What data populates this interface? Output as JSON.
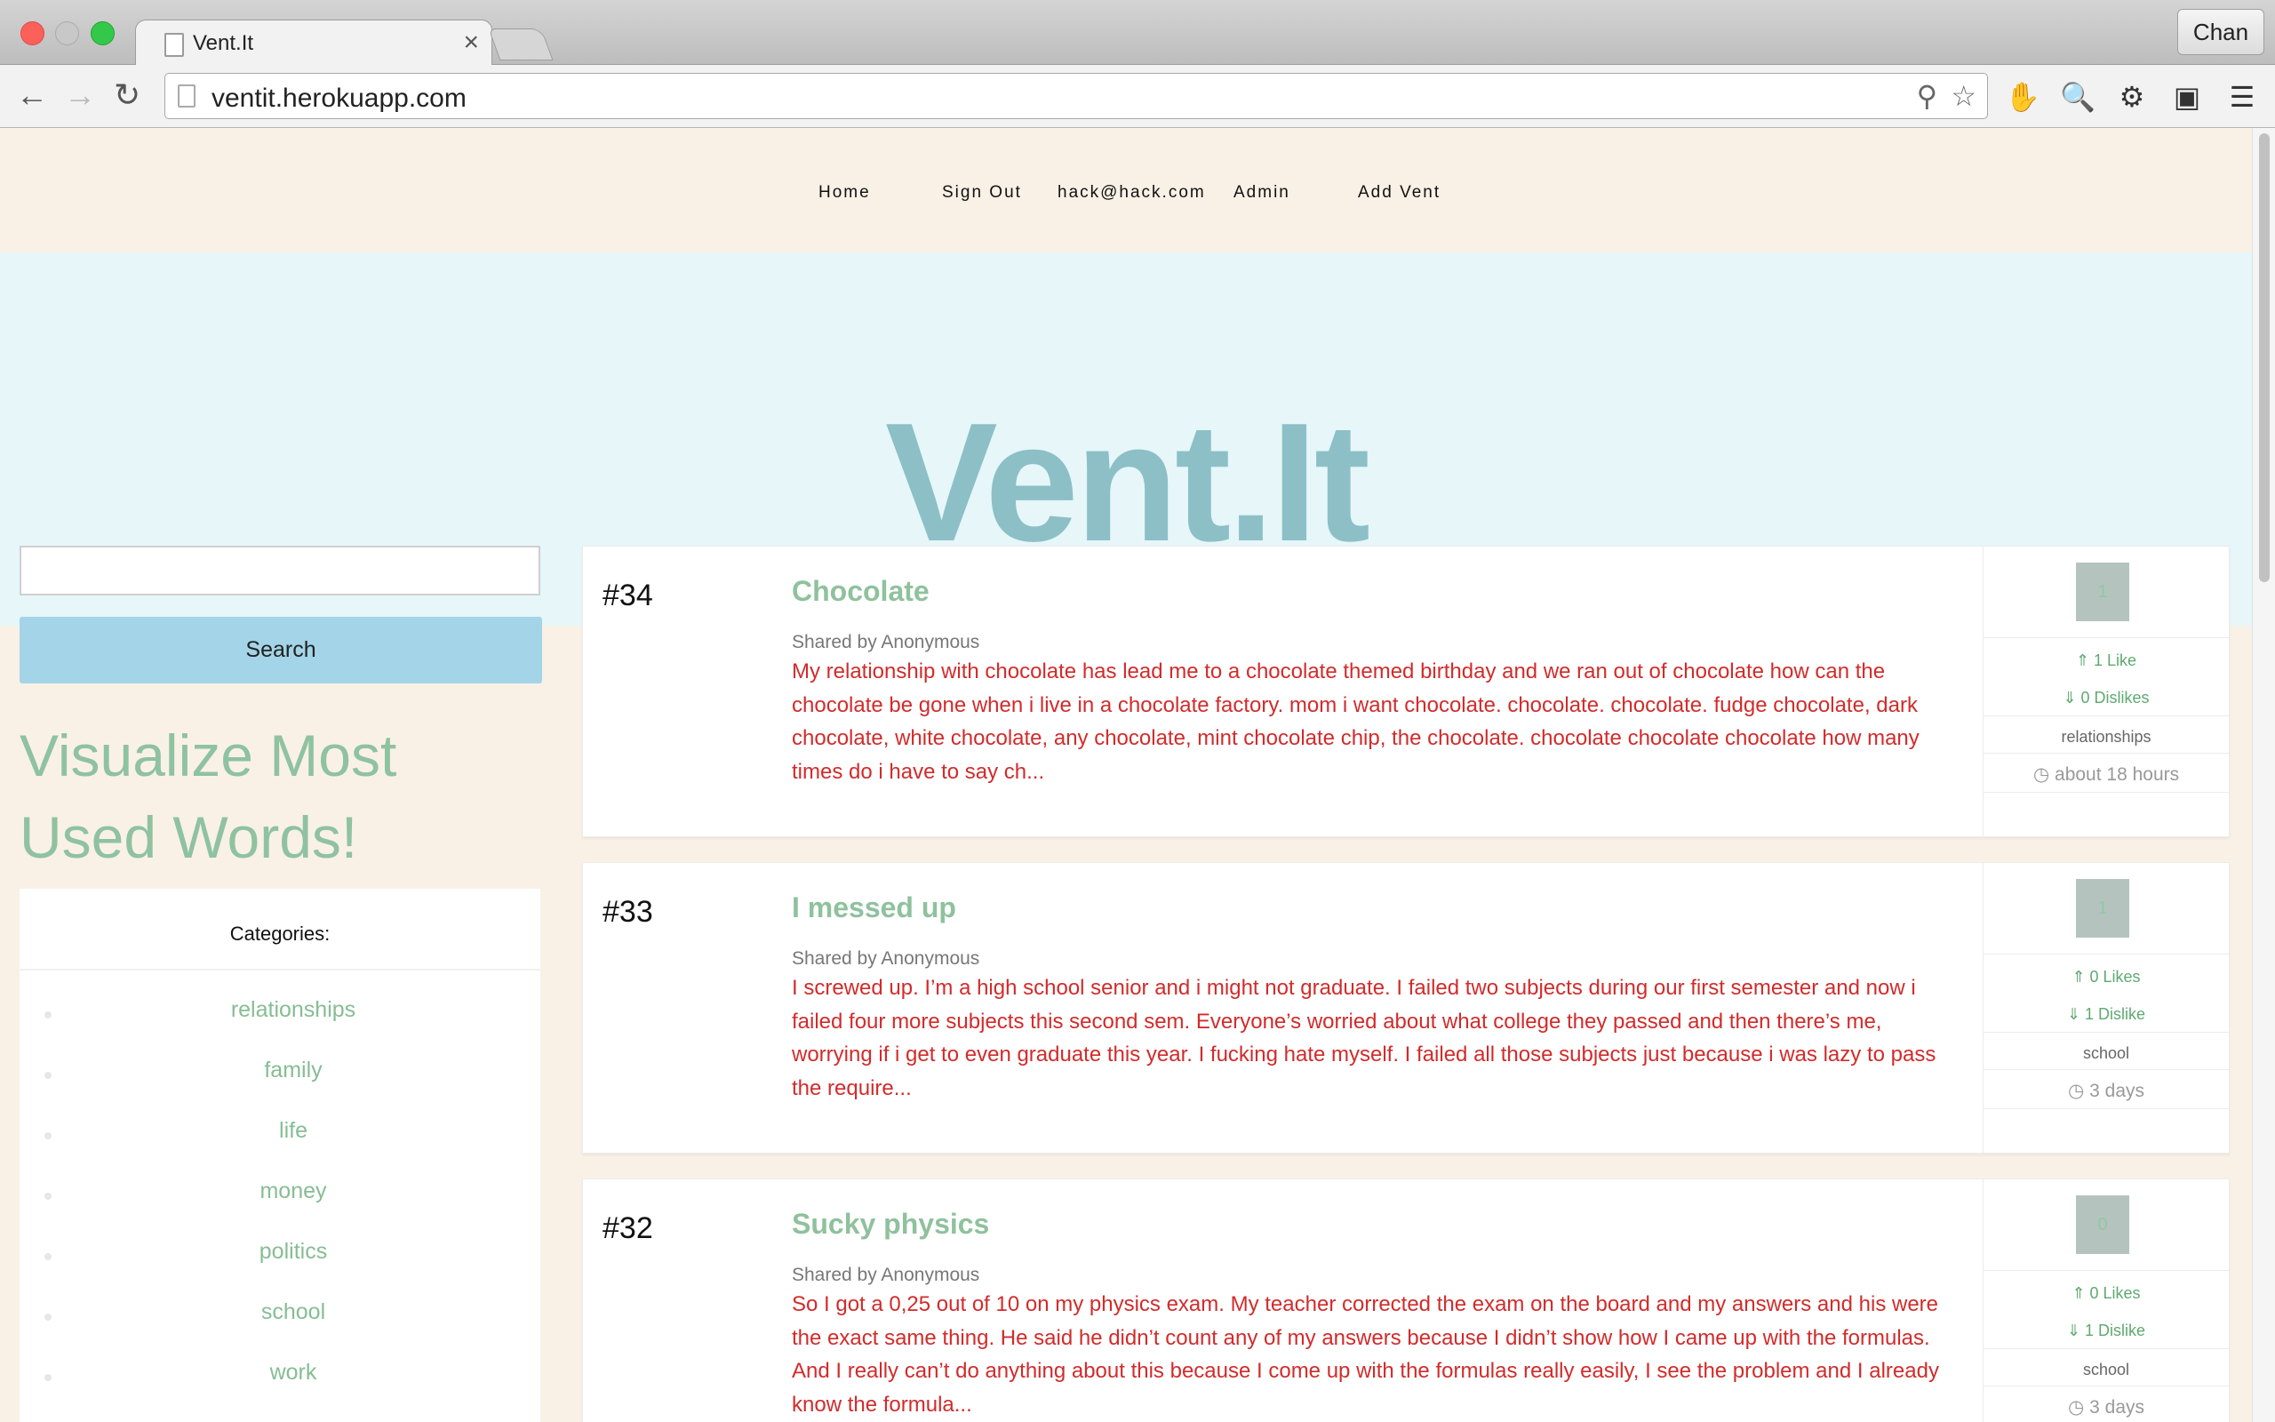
{
  "browser": {
    "tab_title": "Vent.It",
    "tab_close": "×",
    "url": "ventit.herokuapp.com",
    "profile": "Chan",
    "back_glyph": "←",
    "forward_glyph": "→",
    "reload_glyph": "↻",
    "zoom_glyph": "⚲",
    "star_glyph": "☆",
    "ext_adblock_glyph": "✋",
    "ext_magnifier_glyph": "🔍",
    "ext_gear_glyph": "⚙",
    "ext_box_glyph": "▣",
    "menu_glyph": "☰"
  },
  "nav": {
    "home": "Home",
    "sign_out": "Sign Out",
    "email": "hack@hack.com",
    "admin": "Admin",
    "add_vent": "Add Vent"
  },
  "hero": {
    "title": "Vent.It"
  },
  "sidebar": {
    "search_value": "",
    "search_button": "Search",
    "visualize_title": "Visualize Most Used Words!",
    "categories_heading": "Categories:",
    "categories": [
      "relationships",
      "family",
      "life",
      "money",
      "politics",
      "school",
      "work"
    ]
  },
  "vents": [
    {
      "number": "#34",
      "title": "Chocolate",
      "author": "Shared by Anonymous",
      "body": "My relationship with chocolate has lead me to a chocolate themed birthday and we ran out of chocolate how can the chocolate be gone when i live in a chocolate factory. mom i want chocolate. chocolate. chocolate. fudge chocolate, dark chocolate, white chocolate, any chocolate, mint chocolate chip, the chocolate. chocolate chocolate chocolate how many times do i have to say ch...",
      "score": "1",
      "likes": "⇑ 1 Like",
      "dislikes": "⇓ 0 Dislikes",
      "category": "relationships",
      "time": "◷ about 18 hours"
    },
    {
      "number": "#33",
      "title": "I messed up",
      "author": "Shared by Anonymous",
      "body": "I screwed up. I’m a high school senior and i might not graduate. I failed two subjects during our first semester and now i failed four more subjects this second sem. Everyone’s worried about what college they passed and then there’s me, worrying if i get to even graduate this year. I fucking hate myself. I failed all those subjects just because i was lazy to pass the require...",
      "score": "1",
      "likes": "⇑ 0 Likes",
      "dislikes": "⇓ 1 Dislike",
      "category": "school",
      "time": "◷ 3 days"
    },
    {
      "number": "#32",
      "title": "Sucky physics",
      "author": "Shared by Anonymous",
      "body": "So I got a 0,25 out of 10 on my physics exam. My teacher corrected the exam on the board and my answers and his were the exact same thing. He said he didn’t count any of my answers because I didn’t show how I came up with the formulas. And I really can’t do anything about this because I come up with the formulas really easily, I see the problem and I already know the formula...",
      "score": "0",
      "likes": "⇑ 0 Likes",
      "dislikes": "⇓ 1 Dislike",
      "category": "school",
      "time": "◷ 3 days"
    }
  ]
}
